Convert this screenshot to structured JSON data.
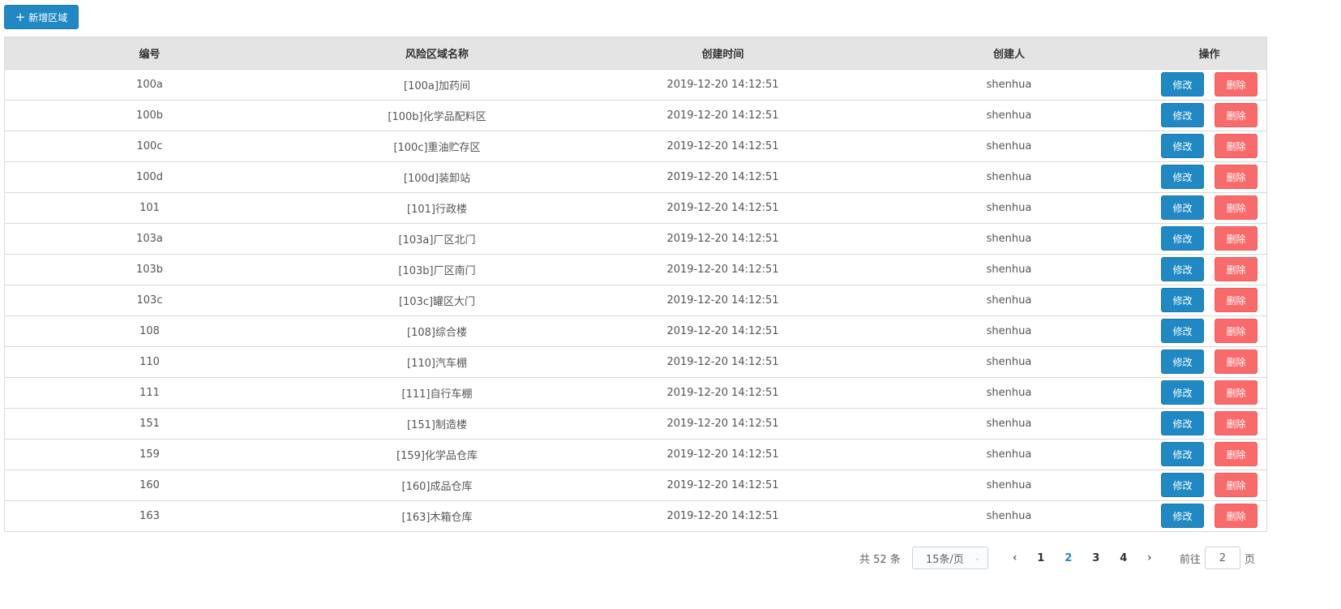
{
  "toolbar": {
    "add_label": "新增区域",
    "add_icon": "plus-icon"
  },
  "table": {
    "headers": {
      "id": "编号",
      "name": "风险区域名称",
      "created_time": "创建时间",
      "creator": "创建人",
      "ops": "操作"
    },
    "edit_label": "修改",
    "delete_label": "删除",
    "rows": [
      {
        "id": "100a",
        "name": "[100a]加药间",
        "time": "2019-12-20 14:12:51",
        "creator": "shenhua"
      },
      {
        "id": "100b",
        "name": "[100b]化学品配料区",
        "time": "2019-12-20 14:12:51",
        "creator": "shenhua"
      },
      {
        "id": "100c",
        "name": "[100c]重油贮存区",
        "time": "2019-12-20 14:12:51",
        "creator": "shenhua"
      },
      {
        "id": "100d",
        "name": "[100d]装卸站",
        "time": "2019-12-20 14:12:51",
        "creator": "shenhua"
      },
      {
        "id": "101",
        "name": "[101]行政楼",
        "time": "2019-12-20 14:12:51",
        "creator": "shenhua"
      },
      {
        "id": "103a",
        "name": "[103a]厂区北门",
        "time": "2019-12-20 14:12:51",
        "creator": "shenhua"
      },
      {
        "id": "103b",
        "name": "[103b]厂区南门",
        "time": "2019-12-20 14:12:51",
        "creator": "shenhua"
      },
      {
        "id": "103c",
        "name": "[103c]罐区大门",
        "time": "2019-12-20 14:12:51",
        "creator": "shenhua"
      },
      {
        "id": "108",
        "name": "[108]综合楼",
        "time": "2019-12-20 14:12:51",
        "creator": "shenhua"
      },
      {
        "id": "110",
        "name": "[110]汽车棚",
        "time": "2019-12-20 14:12:51",
        "creator": "shenhua"
      },
      {
        "id": "111",
        "name": "[111]自行车棚",
        "time": "2019-12-20 14:12:51",
        "creator": "shenhua"
      },
      {
        "id": "151",
        "name": "[151]制造楼",
        "time": "2019-12-20 14:12:51",
        "creator": "shenhua"
      },
      {
        "id": "159",
        "name": "[159]化学品仓库",
        "time": "2019-12-20 14:12:51",
        "creator": "shenhua"
      },
      {
        "id": "160",
        "name": "[160]成品仓库",
        "time": "2019-12-20 14:12:51",
        "creator": "shenhua"
      },
      {
        "id": "163",
        "name": "[163]木箱仓库",
        "time": "2019-12-20 14:12:51",
        "creator": "shenhua"
      }
    ]
  },
  "pagination": {
    "total_text": "共 52 条",
    "page_size": "15条/页",
    "prev_icon": "chevron-left-icon",
    "next_icon": "chevron-right-icon",
    "pages": [
      "1",
      "2",
      "3",
      "4"
    ],
    "current_page": "2",
    "goto_prefix": "前往",
    "goto_value": "2",
    "goto_suffix": "页"
  },
  "colors": {
    "primary": "#2089c3",
    "danger": "#f96a6a",
    "header_bg": "#e4e4e4"
  }
}
